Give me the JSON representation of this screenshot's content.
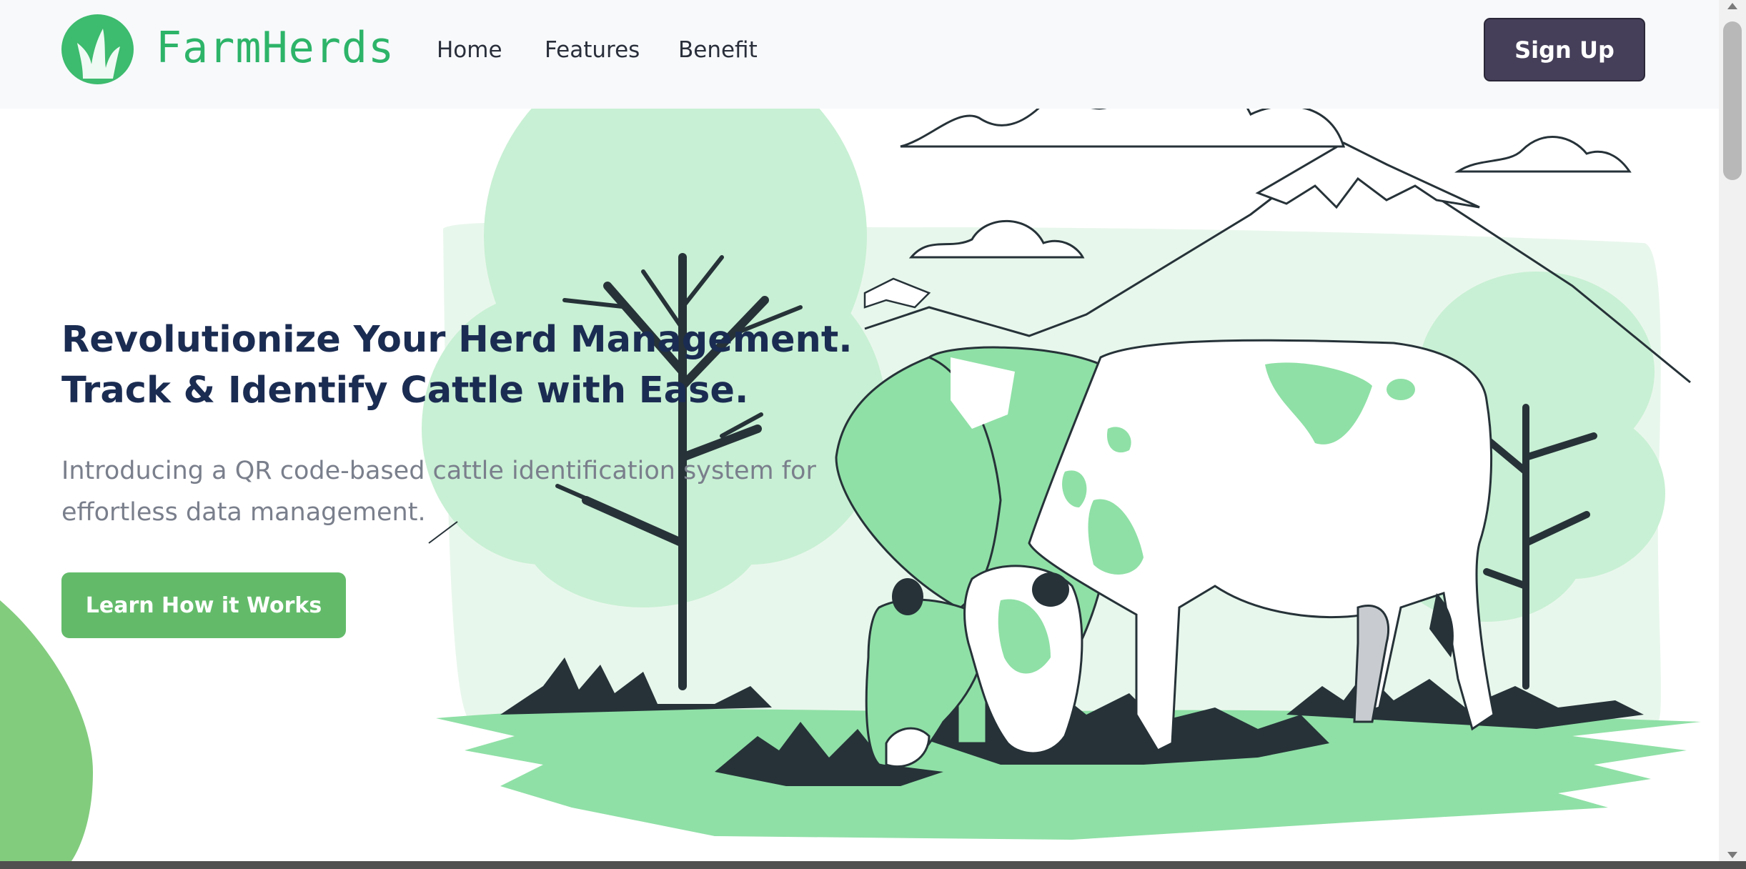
{
  "header": {
    "brand": "FarmHerds",
    "logo_icon": "grass-leaf-icon",
    "nav": [
      {
        "label": "Home"
      },
      {
        "label": "Features"
      },
      {
        "label": "Benefit"
      }
    ],
    "signup_label": "Sign Up"
  },
  "hero": {
    "title_line1": "Revolutionize Your Herd Management.",
    "title_line2": "Track & Identify Cattle with Ease.",
    "subtitle_line1": "Introducing a QR code-based cattle identification system for",
    "subtitle_line2": "effortless data management.",
    "cta_label": "Learn How it Works",
    "illustration_icon": "grazing-cows-illustration"
  },
  "colors": {
    "brand_green": "#2db469",
    "cta_green": "#63bb6a",
    "signup_bg": "#453f5a",
    "title_navy": "#1b2c52",
    "illustration_green": "#8fe0a6",
    "illustration_dark": "#263238"
  }
}
